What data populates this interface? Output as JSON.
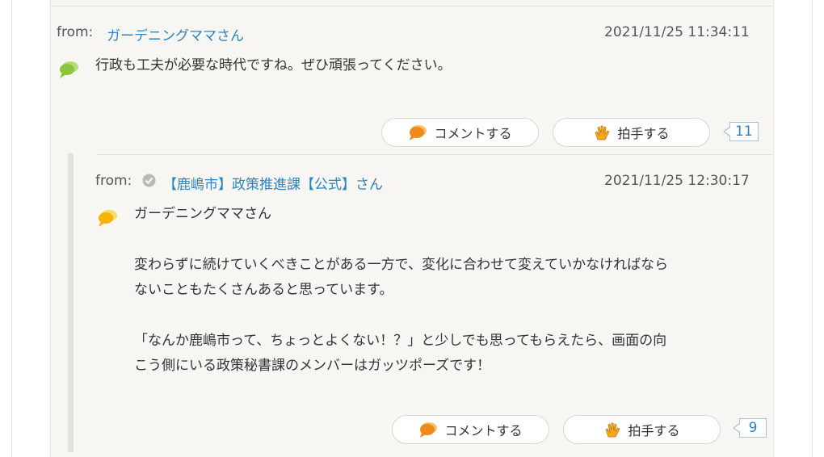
{
  "comment": {
    "from_label": "from:",
    "author": "ガーデニングママさん",
    "timestamp": "2021/11/25 11:34:11",
    "text": "行政も工夫が必要な時代ですね。ぜひ頑張ってください。",
    "comment_button": "コメントする",
    "clap_button": "拍手する",
    "clap_count": "11",
    "icon_color": "#8cc63f"
  },
  "reply": {
    "from_label": "from:",
    "author": "【鹿嶋市】政策推進課【公式】さん",
    "timestamp": "2021/11/25 12:30:17",
    "addressee": "ガーデニングママさん",
    "paragraph1_line1": "変わらずに続けていくべきことがある一方で、変化に合わせて変えていかなければなら",
    "paragraph1_line2": "ないこともたくさんあると思っています。",
    "paragraph2_line1": "「なんか鹿嶋市って、ちょっとよくない！？」と少しでも思ってもらえたら、画面の向",
    "paragraph2_line2": "こう側にいる政策秘書課のメンバーはガッツポーズです！",
    "comment_button": "コメントする",
    "clap_button": "拍手する",
    "clap_count": "9",
    "icon_color": "#f5b400"
  },
  "colors": {
    "link": "#2a84c6",
    "panel": "#f7f6f3"
  }
}
